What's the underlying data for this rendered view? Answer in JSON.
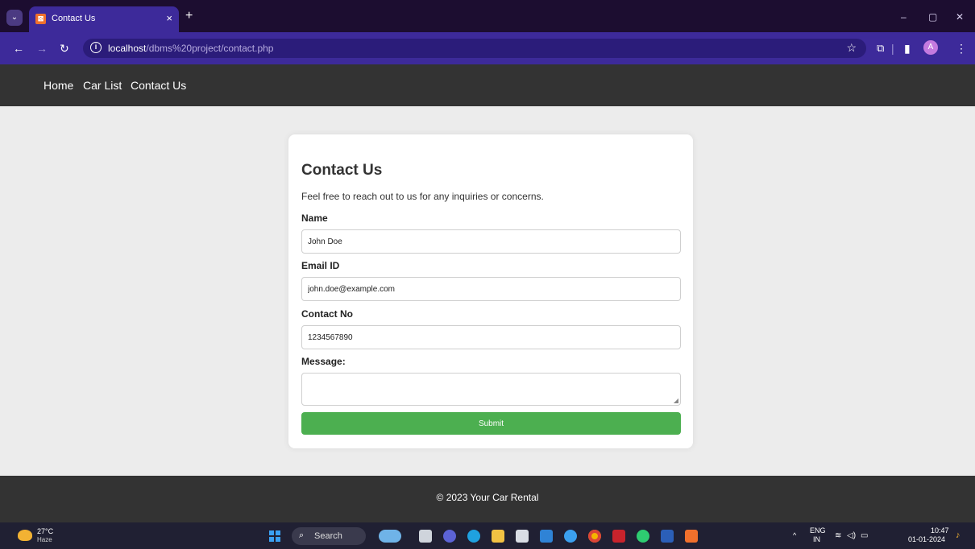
{
  "browser": {
    "tab_title": "Contact Us",
    "tab_close": "×",
    "new_tab": "+",
    "url_host": "localhost",
    "url_path": "/dbms%20project/contact.php",
    "controls": {
      "minimize": "–",
      "maximize": "▢",
      "close": "✕"
    },
    "profile_initial": "A"
  },
  "nav": {
    "links": [
      "Home",
      "Car List",
      "Contact Us"
    ]
  },
  "form": {
    "title": "Contact Us",
    "intro": "Feel free to reach out to us for any inquiries or concerns.",
    "name_label": "Name",
    "name_value": "John Doe",
    "email_label": "Email ID",
    "email_value": "john.doe@example.com",
    "contact_label": "Contact No",
    "contact_value": "1234567890",
    "message_label": "Message:",
    "message_value": "",
    "submit_label": "Submit"
  },
  "footer": {
    "text": "© 2023 Your Car Rental"
  },
  "taskbar": {
    "weather_temp": "27°C",
    "weather_condition": "Haze",
    "search_label": "Search",
    "lang_top": "ENG",
    "lang_bottom": "IN",
    "time": "10:47",
    "date": "01-01-2024"
  },
  "colors": {
    "browser_frame": "#1c0d30",
    "browser_toolbar": "#3d2a9a",
    "site_nav": "#333333",
    "page_background": "#ececec",
    "submit_button": "#4caf50"
  }
}
